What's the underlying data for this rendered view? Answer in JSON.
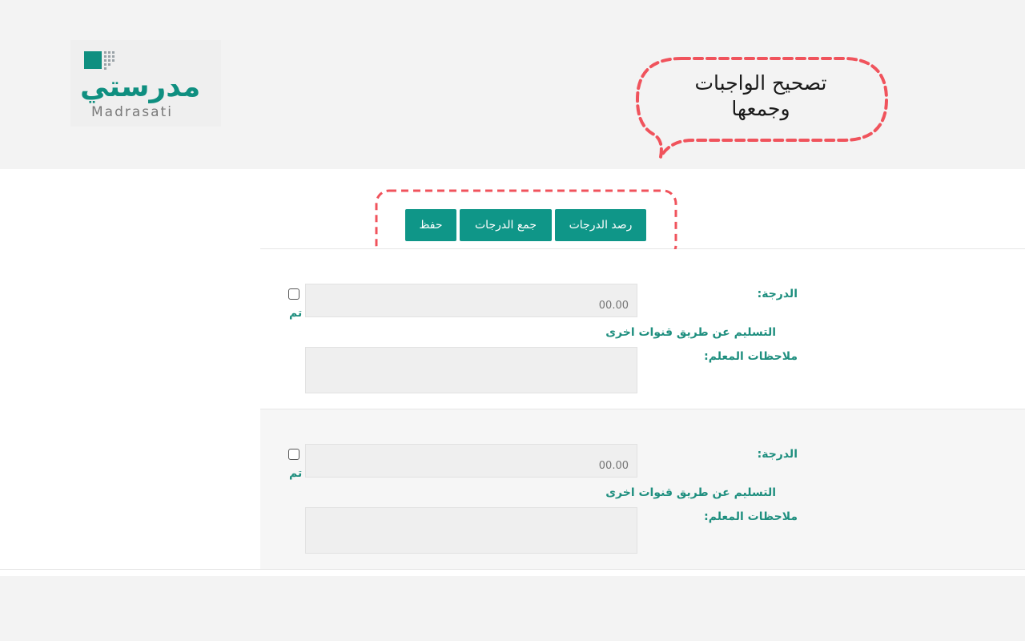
{
  "logo": {
    "arabic": "مدرستي",
    "english": "Madrasati"
  },
  "callout": {
    "line1": "تصحيح الواجبات",
    "line2": "وجمعها"
  },
  "toolbar": {
    "save_label": "حفظ",
    "sum_label": "جمع الدرجات",
    "record_label": "رصد الدرجات"
  },
  "records": [
    {
      "grade_label": "الدرجة:",
      "grade_placeholder": "00.00",
      "done_label": "تم",
      "delivery_label": "التسليم عن طريق قنوات اخرى",
      "notes_label": "ملاحظات المعلم:"
    },
    {
      "grade_label": "الدرجة:",
      "grade_placeholder": "00.00",
      "done_label": "تم",
      "delivery_label": "التسليم عن طريق قنوات اخرى",
      "notes_label": "ملاحظات المعلم:"
    }
  ],
  "colors": {
    "primary": "#0f9688",
    "highlight": "#f0535c",
    "label": "#1f8f7f"
  }
}
